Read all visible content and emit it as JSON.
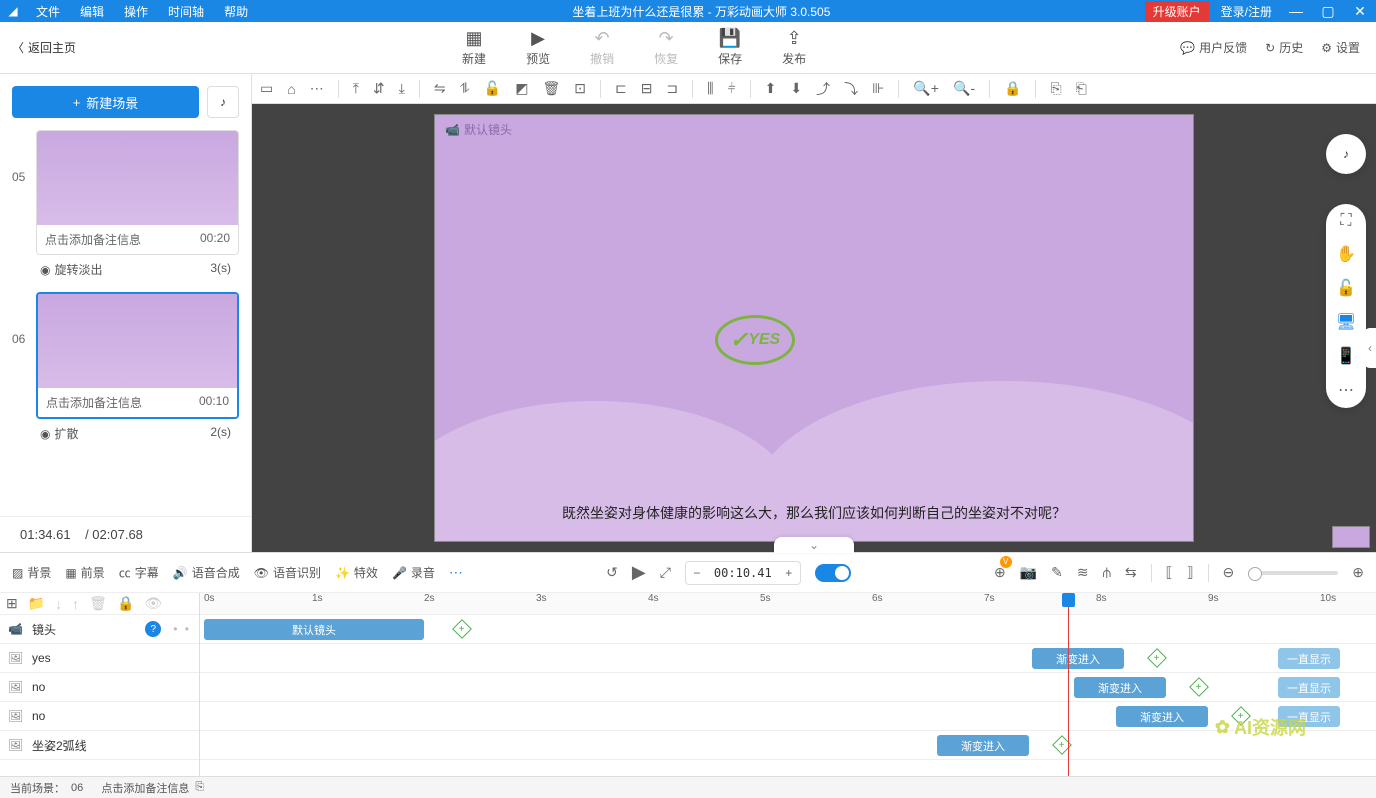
{
  "app": {
    "doc_title": "坐着上班为什么还是很累",
    "app_name": "万彩动画大师 3.0.505",
    "title_sep": " - "
  },
  "menubar": {
    "file": "文件",
    "edit": "编辑",
    "operate": "操作",
    "timeline": "时间轴",
    "help": "帮助"
  },
  "titlebar_right": {
    "upgrade": "升级账户",
    "login": "登录/注册"
  },
  "back_home": "返回主页",
  "main_tb": {
    "new": "新建",
    "preview": "预览",
    "undo": "撤销",
    "redo": "恢复",
    "save": "保存",
    "publish": "发布"
  },
  "right_tb": {
    "feedback": "用户反馈",
    "history": "历史",
    "settings": "设置"
  },
  "left": {
    "new_scene": "新建场景",
    "scene5": {
      "num": "05",
      "note": "点击添加备注信息",
      "dur": "00:20",
      "trans": "旋转淡出",
      "trans_dur": "3(s)"
    },
    "scene6": {
      "num": "06",
      "note": "点击添加备注信息",
      "dur": "00:10",
      "trans": "扩散",
      "trans_dur": "2(s)"
    },
    "time_current": "01:34.61",
    "time_slash": "/ ",
    "time_total": "02:07.68"
  },
  "canvas": {
    "camera_label": "默认镜头",
    "subtitle": "既然坐姿对身体健康的影响这么大，那么我们应该如何判断自己的坐姿对不对呢？",
    "yes": "YES"
  },
  "bp_tabs": {
    "bg": "背景",
    "fg": "前景",
    "subtitle": "字幕",
    "tts": "语音合成",
    "asr": "语音识别",
    "fx": "特效",
    "record": "录音"
  },
  "bp_time": "00:10.41",
  "ruler": {
    "t0": "0s",
    "t1": "1s",
    "t2": "2s",
    "t3": "3s",
    "t4": "4s",
    "t5": "5s",
    "t6": "6s",
    "t7": "7s",
    "t8": "8s",
    "t9": "9s",
    "t10": "10s"
  },
  "tracks": {
    "camera": "镜头",
    "yes": "yes",
    "no1": "no",
    "no2": "no",
    "arc": "坐姿2弧线"
  },
  "clips": {
    "default_cam": "默认镜头",
    "fade_in": "渐变进入",
    "always_show": "一直显示"
  },
  "status": {
    "prefix": "当前场景：",
    "num": "06",
    "text": "点击添加备注信息"
  },
  "watermark": "AI资源网"
}
